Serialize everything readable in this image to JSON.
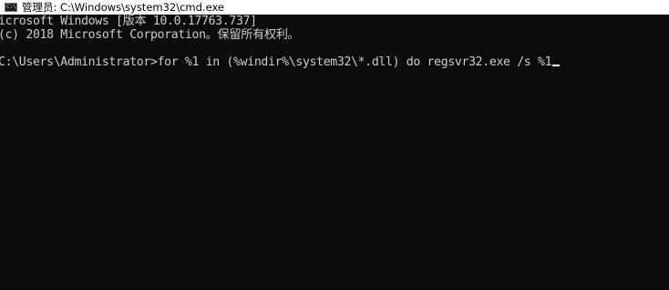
{
  "window": {
    "title": "管理员: C:\\Windows\\system32\\cmd.exe",
    "icon": "cmd-icon",
    "icon_glyph": "C:\\"
  },
  "console": {
    "banner_line1": "icrosoft Windows [版本 10.0.17763.737]",
    "banner_line2": "(c) 2018 Microsoft Corporation。保留所有权利。",
    "prompt": "C:\\Users\\Administrator>",
    "command": "for %1 in (%windir%\\system32\\*.dll) do regsvr32.exe /s %1"
  },
  "colors": {
    "background": "#0c0c0c",
    "foreground": "#cccccc",
    "titlebar": "#ffffff"
  }
}
